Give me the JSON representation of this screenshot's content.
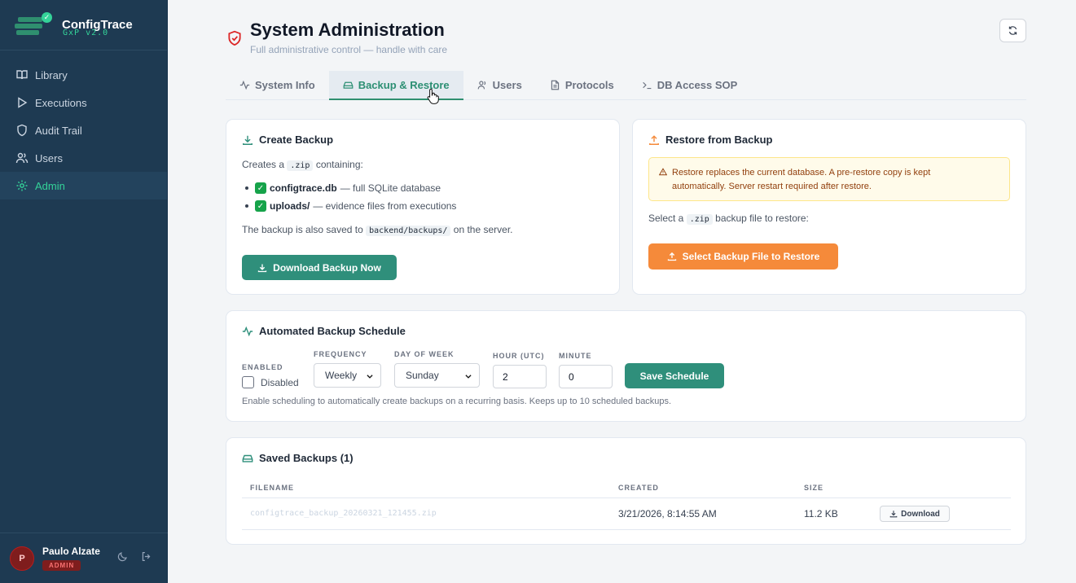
{
  "app": {
    "name": "ConfigTrace",
    "version": "GxP v2.0"
  },
  "sidebar": {
    "items": [
      {
        "label": "Library",
        "icon": "book-icon"
      },
      {
        "label": "Executions",
        "icon": "play-icon"
      },
      {
        "label": "Audit Trail",
        "icon": "shield-icon"
      },
      {
        "label": "Users",
        "icon": "users-icon"
      },
      {
        "label": "Admin",
        "icon": "gear-icon",
        "active": true
      }
    ]
  },
  "user": {
    "initial": "P",
    "name": "Paulo Alzate",
    "role": "ADMIN"
  },
  "page": {
    "title": "System Administration",
    "subtitle": "Full administrative control — handle with care"
  },
  "tabs": [
    {
      "label": "System Info",
      "icon": "activity-icon"
    },
    {
      "label": "Backup & Restore",
      "icon": "drive-icon",
      "active": true
    },
    {
      "label": "Users",
      "icon": "users-icon"
    },
    {
      "label": "Protocols",
      "icon": "document-icon"
    },
    {
      "label": "DB Access SOP",
      "icon": "terminal-icon"
    }
  ],
  "create_backup": {
    "title": "Create Backup",
    "intro_prefix": "Creates a",
    "intro_code": ".zip",
    "intro_suffix": "containing:",
    "items": [
      {
        "name": "configtrace.db",
        "desc": "— full SQLite database"
      },
      {
        "name": "uploads/",
        "desc": "— evidence files from executions"
      }
    ],
    "saved_prefix": "The backup is also saved to",
    "saved_code": "backend/backups/",
    "saved_suffix": "on the server.",
    "button": "Download Backup Now"
  },
  "restore": {
    "title": "Restore from Backup",
    "warning_line1": "Restore replaces the current database. A pre-restore copy is kept",
    "warning_line2": "automatically. Server restart required after restore.",
    "select_prefix": "Select a",
    "select_code": ".zip",
    "select_suffix": "backup file to restore:",
    "button": "Select Backup File to Restore"
  },
  "schedule": {
    "title": "Automated Backup Schedule",
    "enabled_label": "ENABLED",
    "enabled_value": "Disabled",
    "frequency_label": "FREQUENCY",
    "frequency_value": "Weekly",
    "day_label": "DAY OF WEEK",
    "day_value": "Sunday",
    "hour_label": "HOUR (UTC)",
    "hour_value": "2",
    "minute_label": "MINUTE",
    "minute_value": "0",
    "save_button": "Save Schedule",
    "help": "Enable scheduling to automatically create backups on a recurring basis. Keeps up to 10 scheduled backups."
  },
  "saved_backups": {
    "title": "Saved Backups (1)",
    "columns": [
      "FILENAME",
      "CREATED",
      "SIZE"
    ],
    "rows": [
      {
        "filename": "configtrace_backup_20260321_121455.zip",
        "created": "3/21/2026, 8:14:55 AM",
        "size": "11.2 KB",
        "action": "Download"
      }
    ]
  },
  "colors": {
    "sidebar": "#1e3a52",
    "accent": "#2f8f7b",
    "orange": "#f58a3a",
    "active_nav": "#34d399"
  }
}
